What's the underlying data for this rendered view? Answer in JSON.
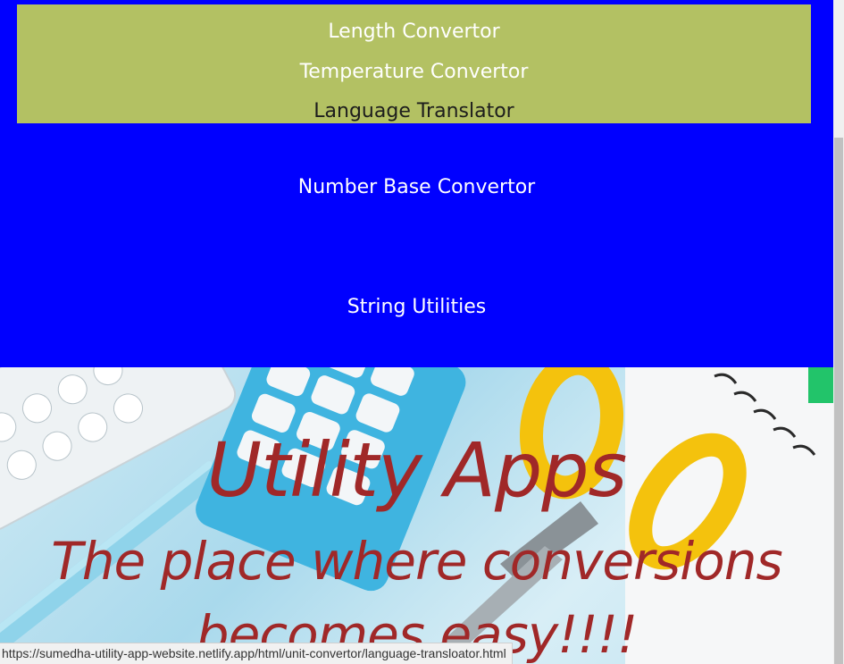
{
  "dropdown": {
    "items": [
      {
        "label": "Length Convertor"
      },
      {
        "label": "Temperature Convertor"
      },
      {
        "label": "Language Translator"
      }
    ]
  },
  "nav": {
    "number_base": "Number Base Convertor",
    "string_utilities": "String Utilities"
  },
  "hero": {
    "title": "Utility Apps",
    "subtitle": "The place where conversions becomes easy!!!!"
  },
  "status_bar": {
    "url": "https://sumedha-utility-app-website.netlify.app/html/unit-convertor/language-transloator.html"
  },
  "colors": {
    "page_background": "#0000ff",
    "dropdown_background": "#b3c163",
    "hero_text": "#a02828"
  }
}
